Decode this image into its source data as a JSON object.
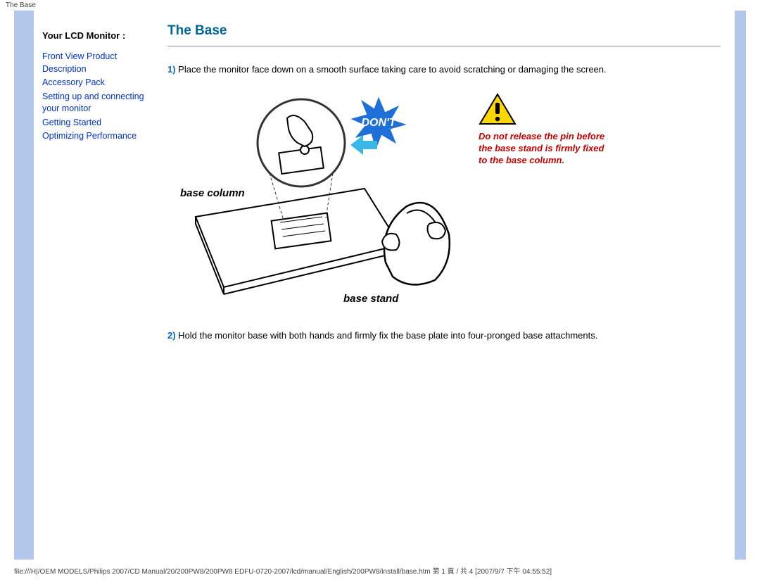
{
  "topbar": "The Base",
  "sidebar": {
    "heading": "Your LCD Monitor :",
    "links": {
      "l0": "Front View Product Description",
      "l1": "Accessory Pack",
      "l2": "Setting up and connecting your monitor",
      "l3": "Getting Started",
      "l4": "Optimizing Performance"
    }
  },
  "content": {
    "title": "The Base",
    "step1_num": "1)",
    "step1_text": " Place the monitor face down on a smooth surface taking care to avoid scratching or damaging the screen.",
    "step2_num": "2)",
    "step2_text": " Hold the monitor base with both hands and firmly fix the base plate into four-pronged base attachments.",
    "diagram": {
      "label_col": "base column",
      "label_stand": "base stand",
      "dont": "DON'T"
    },
    "warning": "Do not release the pin before the base stand is firmly fixed to the base column."
  },
  "footer": "file:///H|/OEM MODELS/Philips 2007/CD Manual/20/200PW8/200PW8 EDFU-0720-2007/lcd/manual/English/200PW8/install/base.htm 第 1 頁 / 共 4  [2007/9/7 下午 04:55:52]"
}
